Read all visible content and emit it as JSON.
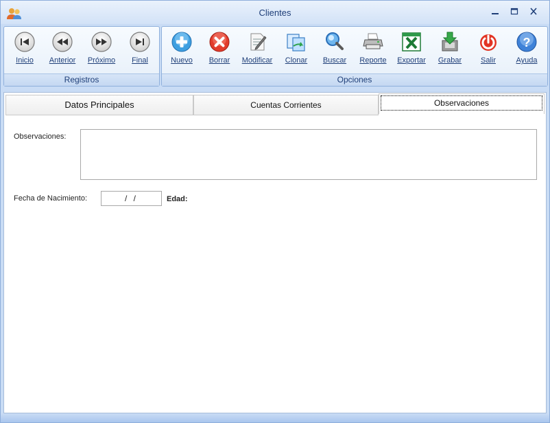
{
  "window": {
    "title": "Clientes"
  },
  "registros": {
    "group_label": "Registros",
    "buttons": {
      "inicio": "Inicio",
      "anterior": "Anterior",
      "proximo": "Próximo",
      "final": "Final"
    }
  },
  "opciones": {
    "group_label": "Opciones",
    "buttons": {
      "nuevo": "Nuevo",
      "borrar": "Borrar",
      "modificar": "Modificar",
      "clonar": "Clonar",
      "buscar": "Buscar",
      "reporte": "Reporte",
      "exportar": "Exportar",
      "grabar": "Grabar",
      "salir": "Salir",
      "ayuda": "Ayuda"
    }
  },
  "tabs": {
    "datos_principales": "Datos Principales",
    "cuentas_corrientes": "Cuentas Corrientes",
    "observaciones": "Observaciones",
    "active": "observaciones"
  },
  "form": {
    "observaciones_label": "Observaciones:",
    "observaciones_value": "",
    "fecha_label": "Fecha de Nacimiento:",
    "fecha_value": "/  /",
    "edad_label": "Edad:"
  },
  "icons": {
    "app": "users-icon",
    "minimize": "minimize-icon",
    "maximize": "maximize-icon",
    "close": "close-icon",
    "inicio": "first-record-icon",
    "anterior": "previous-record-icon",
    "proximo": "next-record-icon",
    "final": "last-record-icon",
    "nuevo": "plus-icon",
    "borrar": "delete-icon",
    "modificar": "edit-document-icon",
    "clonar": "clone-icon",
    "buscar": "magnifier-icon",
    "reporte": "printer-icon",
    "exportar": "excel-icon",
    "grabar": "save-download-icon",
    "salir": "power-icon",
    "ayuda": "help-icon"
  },
  "colors": {
    "accent": "#1e3e78",
    "window_frame": "#c9dcf5",
    "group_border": "#8fb0dc"
  }
}
